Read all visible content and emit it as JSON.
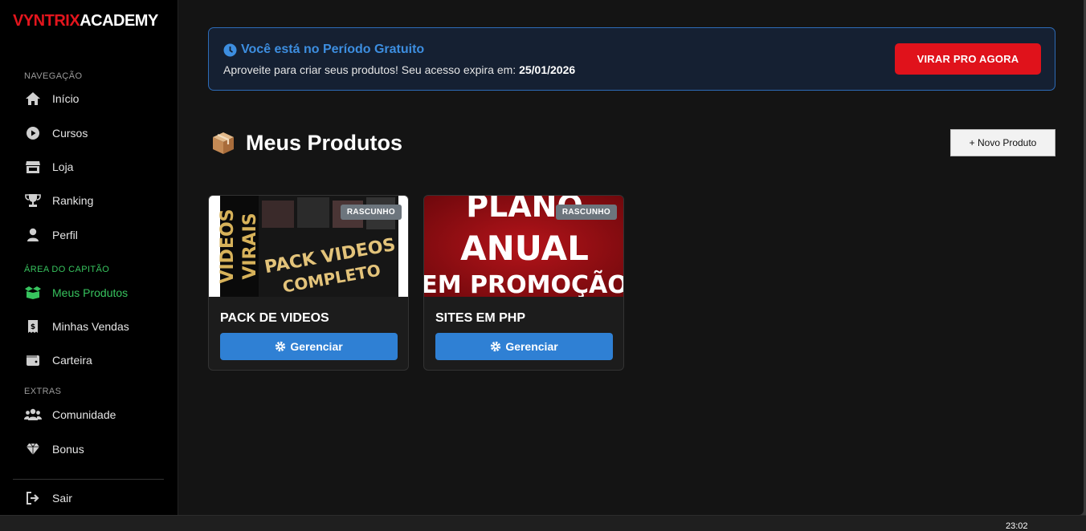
{
  "sidebar": {
    "logo": {
      "part1": "VYNTRIX",
      "part2": "ACADEMY"
    },
    "sections": {
      "navegacao": "NAVEGAÇÃO",
      "area": "ÁREA DO CAPITÃO",
      "extras": "EXTRAS"
    },
    "items": [
      {
        "label": "Início",
        "icon": "home-icon"
      },
      {
        "label": "Cursos",
        "icon": "play-circle-icon"
      },
      {
        "label": "Loja",
        "icon": "store-icon"
      },
      {
        "label": "Ranking",
        "icon": "trophy-icon"
      },
      {
        "label": "Perfil",
        "icon": "user-icon"
      },
      {
        "label": "Meus Produtos",
        "icon": "box-open-icon",
        "active": true
      },
      {
        "label": "Minhas Vendas",
        "icon": "receipt-icon"
      },
      {
        "label": "Carteira",
        "icon": "wallet-icon"
      },
      {
        "label": "Comunidade",
        "icon": "users-icon"
      },
      {
        "label": "Bonus",
        "icon": "gem-icon"
      },
      {
        "label": "Sair",
        "icon": "logout-icon"
      }
    ]
  },
  "banner": {
    "title": "Você está no Período Gratuito",
    "subtitle": "Aproveite para criar seus produtos! Seu acesso expira em:",
    "expiry": "25/01/2026",
    "cta": "VIRAR PRO AGORA"
  },
  "main": {
    "title": "Meus Produtos",
    "new_button": "+ Novo Produto"
  },
  "products": [
    {
      "name": "PACK DE VIDEOS",
      "badge": "RASCUNHO",
      "thumb_text": [
        "PACK VIDEOS",
        "COMPLETO",
        "VIDEOS",
        "VIRAIS"
      ],
      "manage": "Gerenciar"
    },
    {
      "name": "SITES EM PHP",
      "badge": "RASCUNHO",
      "thumb_text": [
        "PLANO",
        "ANUAL",
        "EM PROMOÇÃO"
      ],
      "manage": "Gerenciar"
    }
  ],
  "taskbar": {
    "time": "23:02"
  },
  "colors": {
    "accent_red": "#e3151d",
    "accent_green": "#37c35e",
    "accent_blue": "#2f80d4"
  }
}
